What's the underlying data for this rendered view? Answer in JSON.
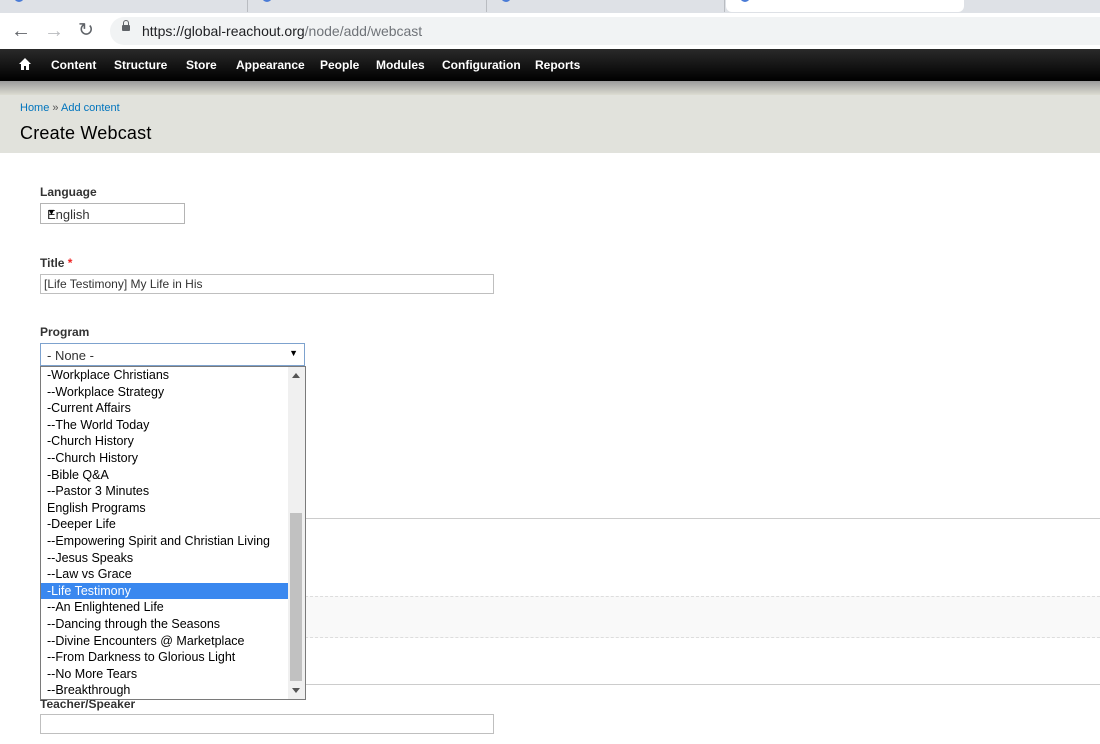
{
  "browser": {
    "url_host": "https://global-reachout.org",
    "url_path": "/node/add/webcast"
  },
  "toolbar": {
    "items": [
      "Content",
      "Structure",
      "Store",
      "Appearance",
      "People",
      "Modules",
      "Configuration",
      "Reports"
    ]
  },
  "breadcrumb": {
    "home": "Home",
    "separator": "»",
    "add_content": "Add content"
  },
  "page": {
    "title": "Create Webcast"
  },
  "form": {
    "language": {
      "label": "Language",
      "value": "English"
    },
    "title": {
      "label": "Title",
      "required_mark": "*",
      "value": "[Life Testimony] My Life in His"
    },
    "program": {
      "label": "Program",
      "value": "- None -",
      "options": [
        "-Workplace Christians",
        "--Workplace Strategy",
        "-Current Affairs",
        "--The World Today",
        "-Church History",
        "--Church History",
        "-Bible Q&A",
        "--Pastor 3 Minutes",
        "English Programs",
        "-Deeper Life",
        "--Empowering Spirit and Christian Living",
        "--Jesus Speaks",
        "--Law vs Grace",
        "-Life Testimony",
        "--An Enlightened Life",
        "--Dancing through the Seasons",
        "--Divine Encounters @ Marketplace",
        "--From Darkness to Glorious Light",
        "--No More Tears",
        "--Breakthrough"
      ],
      "highlighted": "-Life Testimony"
    },
    "speaker": {
      "label": "Teacher/Speaker",
      "value": ""
    }
  },
  "colors": {
    "highlight": "#3a88ef",
    "link": "#0074bd",
    "header_bg": "#e1e2dc"
  }
}
